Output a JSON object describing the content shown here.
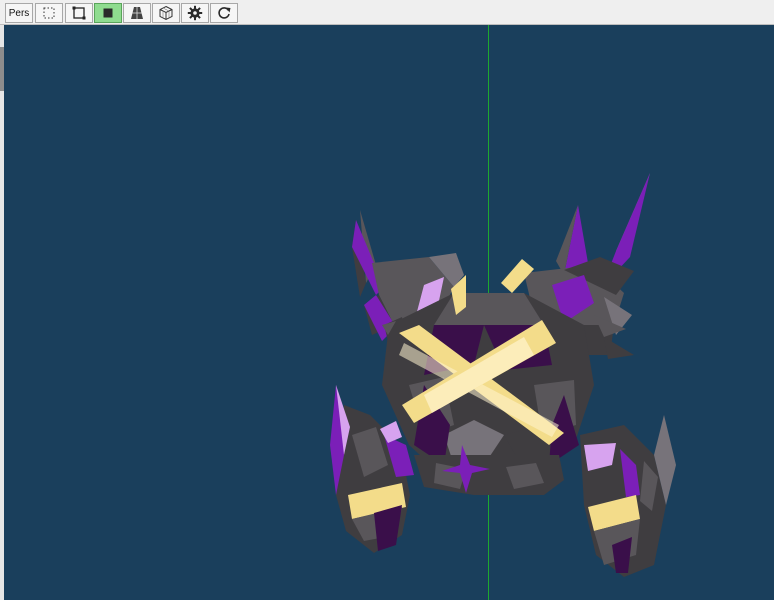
{
  "toolbar": {
    "projection_label": "Pers",
    "buttons": [
      {
        "name": "select-mode",
        "icon": "dotted-square-icon"
      },
      {
        "name": "frame-view",
        "icon": "frame-square-icon"
      },
      {
        "name": "solid-shading",
        "icon": "solid-square-icon",
        "active": true
      },
      {
        "name": "perspective-plane",
        "icon": "trapezoid-plane-icon"
      },
      {
        "name": "wireframe-cube",
        "icon": "wireframe-cube-icon"
      },
      {
        "name": "settings",
        "icon": "gear-icon"
      },
      {
        "name": "reset-view",
        "icon": "refresh-icon"
      }
    ]
  },
  "viewport": {
    "background": "#1a3f5c",
    "axis_color": "#1ea82f",
    "model_name": "armour-model",
    "colors": {
      "armour_dark": "#3f3d40",
      "armour_mid": "#59565a",
      "armour_light": "#77737a",
      "purple": "#7b1fb8",
      "purple_dark": "#3a0f4a",
      "lavender": "#d7a3ef",
      "gold": "#f3dc8a",
      "gold_light": "#fff4cf"
    }
  },
  "colors": {
    "toolbar_bg": "#efefef",
    "active_button": "#8fdc8f"
  }
}
